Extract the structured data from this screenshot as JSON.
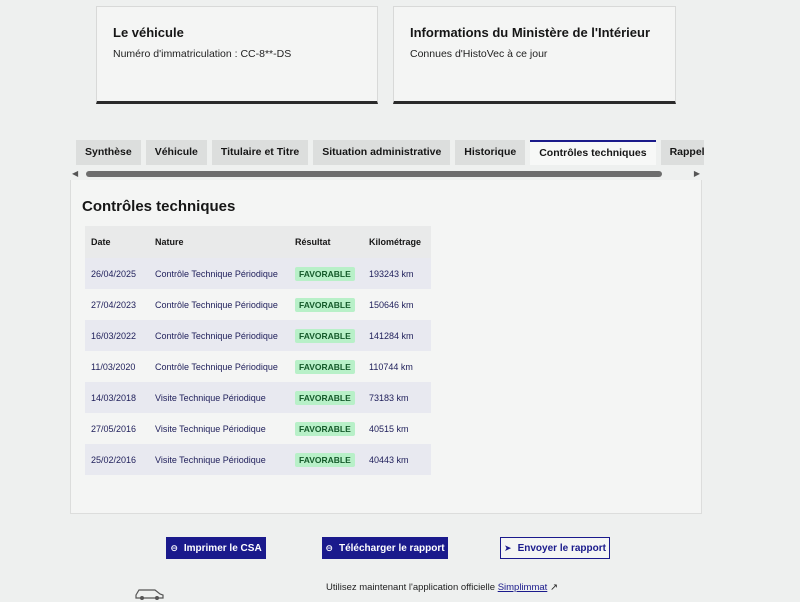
{
  "cards": {
    "vehicle": {
      "title": "Le véhicule",
      "text": "Numéro d'immatriculation : CC-8**-DS"
    },
    "ministere": {
      "title": "Informations du Ministère de l'Intérieur",
      "text": "Connues d'HistoVec à ce jour"
    }
  },
  "tabs": [
    {
      "label": "Synthèse",
      "active": false
    },
    {
      "label": "Véhicule",
      "active": false
    },
    {
      "label": "Titulaire et Titre",
      "active": false
    },
    {
      "label": "Situation administrative",
      "active": false
    },
    {
      "label": "Historique",
      "active": false
    },
    {
      "label": "Contrôles techniques",
      "active": true
    },
    {
      "label": "Rappels constructeur",
      "active": false
    }
  ],
  "section": {
    "title": "Contrôles techniques",
    "headers": {
      "date": "Date",
      "nature": "Nature",
      "result": "Résultat",
      "km": "Kilométrage"
    },
    "rows": [
      {
        "date": "26/04/2025",
        "nature": "Contrôle Technique Périodique",
        "result": "FAVORABLE",
        "km": "193243 km"
      },
      {
        "date": "27/04/2023",
        "nature": "Contrôle Technique Périodique",
        "result": "FAVORABLE",
        "km": "150646 km"
      },
      {
        "date": "16/03/2022",
        "nature": "Contrôle Technique Périodique",
        "result": "FAVORABLE",
        "km": "141284 km"
      },
      {
        "date": "11/03/2020",
        "nature": "Contrôle Technique Périodique",
        "result": "FAVORABLE",
        "km": "110744 km"
      },
      {
        "date": "14/03/2018",
        "nature": "Visite Technique Périodique",
        "result": "FAVORABLE",
        "km": "73183 km"
      },
      {
        "date": "27/05/2016",
        "nature": "Visite Technique Périodique",
        "result": "FAVORABLE",
        "km": "40515 km"
      },
      {
        "date": "25/02/2016",
        "nature": "Visite Technique Périodique",
        "result": "FAVORABLE",
        "km": "40443 km"
      }
    ]
  },
  "actions": {
    "print": "Imprimer le CSA",
    "download": "Télécharger le rapport",
    "send": "Envoyer le rapport"
  },
  "footer": {
    "line1_prefix": "Utilisez maintenant l'application officielle",
    "link": "Simplimmat"
  },
  "colors": {
    "primary": "#1a1a8c",
    "badge_bg": "#b8f0c8",
    "badge_text": "#145a2a"
  }
}
